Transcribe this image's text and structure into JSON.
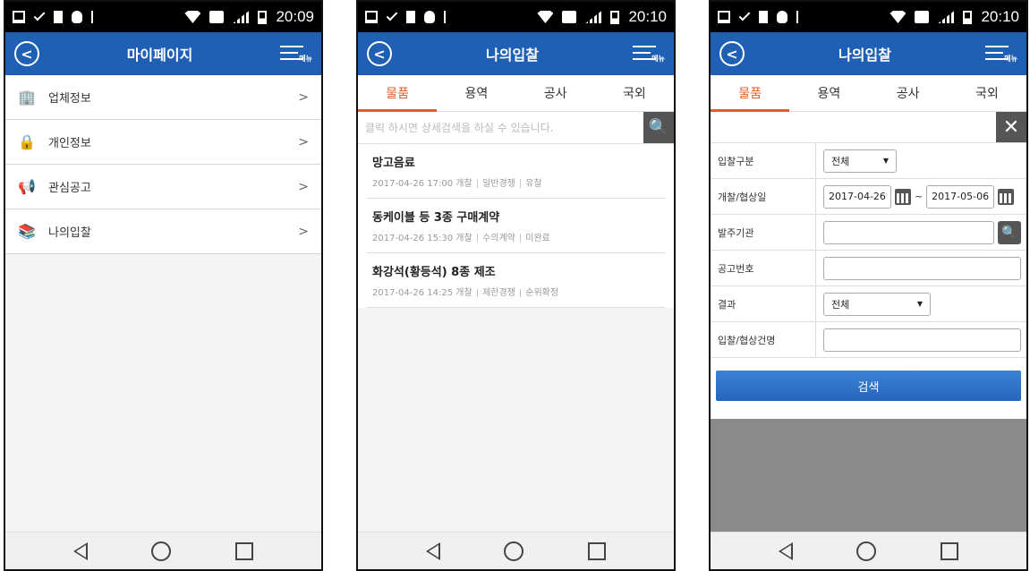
{
  "status_bar": [
    {
      "time": "20:09"
    },
    {
      "time": "20:10"
    },
    {
      "time": "20:10"
    }
  ],
  "phone1": {
    "title": "마이페이지",
    "menu_label": "메뉴",
    "items": [
      {
        "label": "업체정보",
        "icon": "building-icon"
      },
      {
        "label": "개인정보",
        "icon": "lock-icon"
      },
      {
        "label": "관심공고",
        "icon": "megaphone-icon"
      },
      {
        "label": "나의입찰",
        "icon": "books-icon"
      }
    ]
  },
  "phone2": {
    "title": "나의입찰",
    "menu_label": "메뉴",
    "tabs": [
      "물품",
      "용역",
      "공사",
      "국외"
    ],
    "active_tab": 0,
    "search_placeholder": "클릭 하시면 상세검색을 하실 수 있습니다.",
    "bids": [
      {
        "title": "망고음료",
        "datetime": "2017-04-26 17:00 개찰",
        "type": "일반경쟁",
        "result": "유찰"
      },
      {
        "title": "동케이블 등 3종 구매계약",
        "datetime": "2017-04-26 15:30 개찰",
        "type": "수의계약",
        "result": "미완료"
      },
      {
        "title": "화강석(황등석) 8종 제조",
        "datetime": "2017-04-26 14:25 개찰",
        "type": "제한경쟁",
        "result": "순위확정"
      }
    ]
  },
  "phone3": {
    "title": "나의입찰",
    "menu_label": "메뉴",
    "tabs": [
      "물품",
      "용역",
      "공사",
      "국외"
    ],
    "active_tab": 0,
    "form": {
      "bid_type_label": "입찰구분",
      "bid_type_value": "전체",
      "date_label": "개찰/협상일",
      "date_from": "2017-04-26",
      "date_sep": "~",
      "date_to": "2017-05-06",
      "agency_label": "발주기관",
      "notice_no_label": "공고번호",
      "result_label": "결과",
      "result_value": "전체",
      "bid_name_label": "입찰/협상건명"
    },
    "submit_label": "검색"
  },
  "colors": {
    "header_blue": "#1f5fb4",
    "active_tab": "#e45a2a",
    "button_gray": "#555555"
  }
}
